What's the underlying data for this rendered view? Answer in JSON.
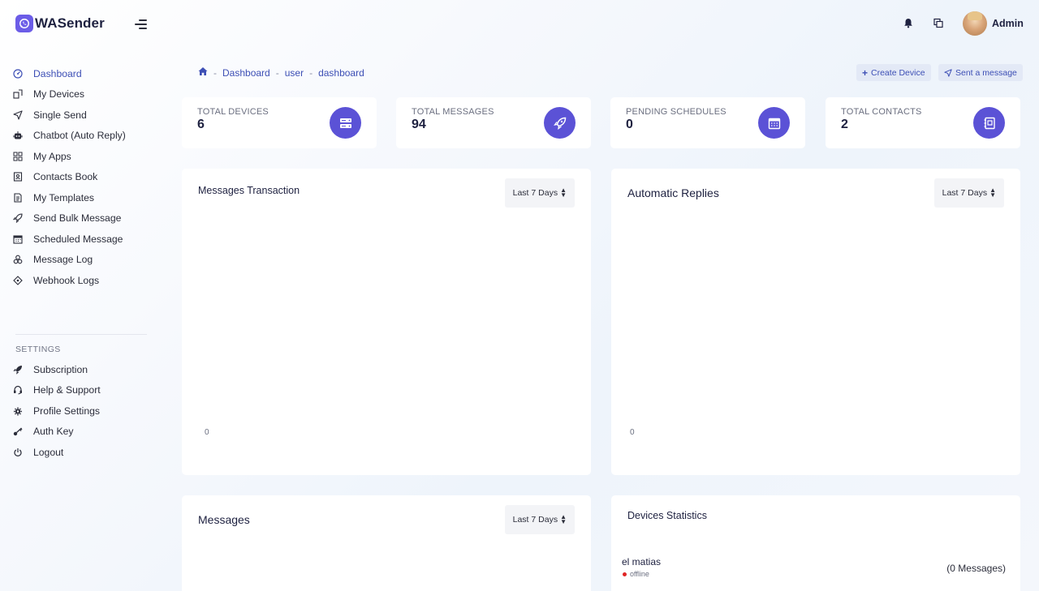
{
  "brand": {
    "name": "WASender",
    "accent": "#6b5ce7"
  },
  "header": {
    "user_name": "Admin",
    "icons": [
      "bell-icon",
      "copy-icon"
    ]
  },
  "sidebar": {
    "items": [
      {
        "label": "Dashboard",
        "icon": "dashboard-icon",
        "active": true
      },
      {
        "label": "My Devices",
        "icon": "devices-icon"
      },
      {
        "label": "Single Send",
        "icon": "send-icon"
      },
      {
        "label": "Chatbot (Auto Reply)",
        "icon": "robot-icon"
      },
      {
        "label": "My Apps",
        "icon": "apps-icon"
      },
      {
        "label": "Contacts Book",
        "icon": "contacts-icon"
      },
      {
        "label": "My Templates",
        "icon": "template-icon"
      },
      {
        "label": "Send Bulk Message",
        "icon": "rocket-icon"
      },
      {
        "label": "Scheduled Message",
        "icon": "calendar-icon"
      },
      {
        "label": "Message Log",
        "icon": "log-icon"
      },
      {
        "label": "Webhook Logs",
        "icon": "webhook-icon"
      }
    ],
    "settings_label": "SETTINGS",
    "settings_items": [
      {
        "label": "Subscription",
        "icon": "rocket-icon"
      },
      {
        "label": "Help & Support",
        "icon": "headset-icon"
      },
      {
        "label": "Profile Settings",
        "icon": "gear-icon"
      },
      {
        "label": "Auth Key",
        "icon": "key-icon"
      },
      {
        "label": "Logout",
        "icon": "power-icon"
      }
    ]
  },
  "breadcrumb": {
    "sep": "-",
    "items": [
      "Dashboard",
      "user",
      "dashboard"
    ]
  },
  "actions": {
    "create_device": "Create Device",
    "send_message": "Sent a message"
  },
  "stats": [
    {
      "label": "TOTAL DEVICES",
      "value": "6",
      "icon": "server-icon"
    },
    {
      "label": "TOTAL MESSAGES",
      "value": "94",
      "icon": "rocket-icon"
    },
    {
      "label": "PENDING SCHEDULES",
      "value": "0",
      "icon": "calendar-icon"
    },
    {
      "label": "TOTAL CONTACTS",
      "value": "2",
      "icon": "contact-book-icon"
    }
  ],
  "panels": {
    "messages_transaction": {
      "title": "Messages Transaction",
      "range": "Last 7 Days",
      "zero": "0"
    },
    "automatic_replies": {
      "title": "Automatic Replies",
      "range": "Last 7 Days",
      "zero": "0"
    },
    "messages": {
      "title": "Messages",
      "range": "Last 7 Days"
    },
    "devices_statistics": {
      "title": "Devices Statistics",
      "devices": [
        {
          "name": "el matias",
          "status": "offline",
          "count": "(0 Messages)"
        }
      ]
    }
  }
}
